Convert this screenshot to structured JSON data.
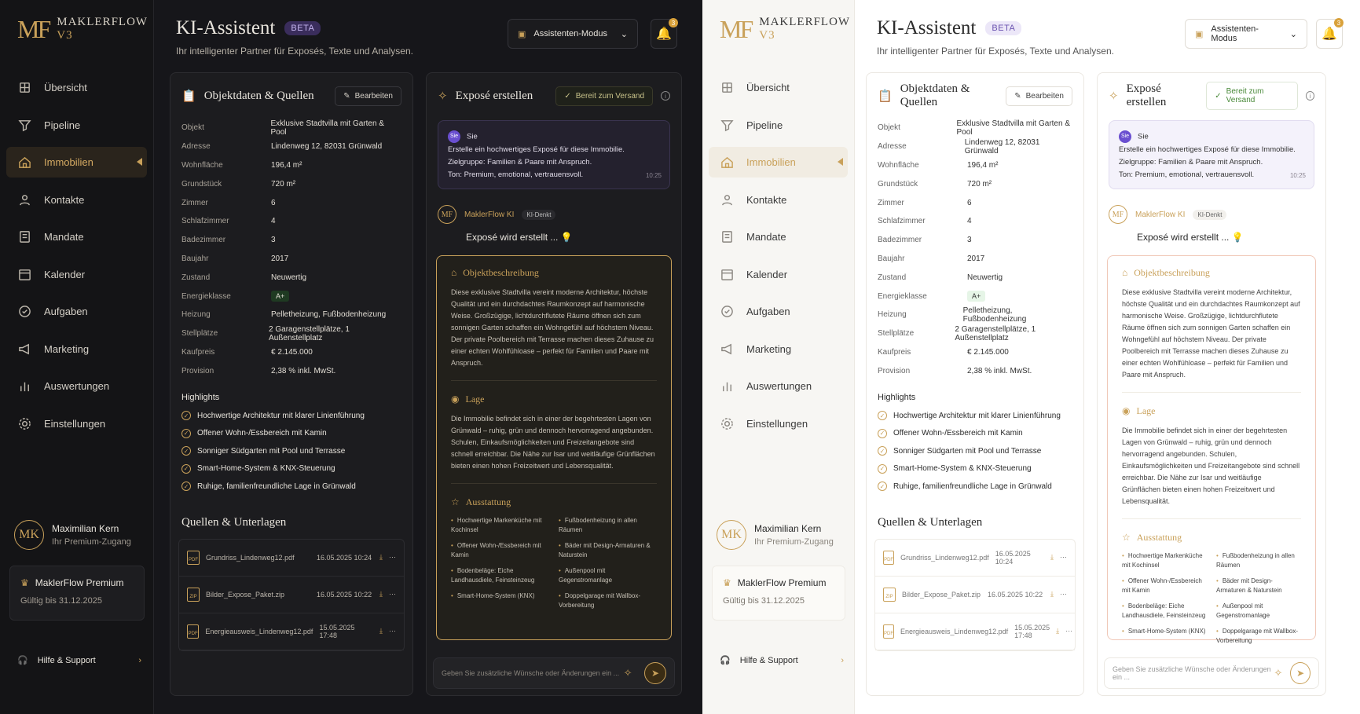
{
  "logo": {
    "mark": "MF",
    "text": "MAKLERFLOW",
    "version": "V3"
  },
  "nav": [
    "Übersicht",
    "Pipeline",
    "Immobilien",
    "Kontakte",
    "Mandate",
    "Kalender",
    "Aufgaben",
    "Marketing",
    "Auswertungen",
    "Einstellungen"
  ],
  "nav_icons": [
    "grid-icon",
    "funnel-icon",
    "home-icon",
    "contacts-icon",
    "contract-icon",
    "calendar-icon",
    "check-circle-icon",
    "megaphone-icon",
    "bar-chart-icon",
    "gear-icon"
  ],
  "user": {
    "initials": "MK",
    "name": "Maximilian Kern",
    "plan": "Ihr Premium-Zugang"
  },
  "premium": {
    "title": "MaklerFlow Premium",
    "valid": "Gültig bis 31.12.2025"
  },
  "help": "Hilfe & Support",
  "page": {
    "title": "KI-Assistent",
    "beta": "BETA",
    "subtitle": "Ihr intelligenter Partner für Exposés, Texte und Analysen.",
    "mode": "Assistenten-Modus",
    "notifications": "3"
  },
  "object": {
    "title": "Objektdaten & Quellen",
    "edit": "Bearbeiten",
    "rows": [
      {
        "k": "Objekt",
        "v": "Exklusive Stadtvilla mit Garten & Pool"
      },
      {
        "k": "Adresse",
        "v": "Lindenweg 12, 82031 Grünwald"
      },
      {
        "k": "Wohnfläche",
        "v": "196,4 m²"
      },
      {
        "k": "Grundstück",
        "v": "720 m²"
      },
      {
        "k": "Zimmer",
        "v": "6"
      },
      {
        "k": "Schlafzimmer",
        "v": "4"
      },
      {
        "k": "Badezimmer",
        "v": "3"
      },
      {
        "k": "Baujahr",
        "v": "2017"
      },
      {
        "k": "Zustand",
        "v": "Neuwertig"
      },
      {
        "k": "Energieklasse",
        "v": "A+"
      },
      {
        "k": "Heizung",
        "v": "Pelletheizung, Fußbodenheizung"
      },
      {
        "k": "Stellplätze",
        "v": "2 Garagenstellplätze, 1 Außenstellplatz"
      },
      {
        "k": "Kaufpreis",
        "v": "€ 2.145.000"
      },
      {
        "k": "Provision",
        "v": "2,38 % inkl. MwSt."
      }
    ],
    "highlights_title": "Highlights",
    "highlights": [
      "Hochwertige Architektur mit klarer Linienführung",
      "Offener Wohn-/Essbereich mit Kamin",
      "Sonniger Südgarten mit Pool und Terrasse",
      "Smart-Home-System & KNX-Steuerung",
      "Ruhige, familienfreundliche Lage in Grünwald"
    ],
    "sources_title": "Quellen & Unterlagen",
    "files": [
      {
        "name": "Grundriss_Lindenweg12.pdf",
        "date": "16.05.2025 10:24",
        "type": "PDF"
      },
      {
        "name": "Bilder_Expose_Paket.zip",
        "date": "16.05.2025 10:22",
        "type": "ZIP"
      },
      {
        "name": "Energieausweis_Lindenweg12.pdf",
        "date": "15.05.2025 17:48",
        "type": "PDF"
      }
    ]
  },
  "expose": {
    "title": "Exposé erstellen",
    "ready": "Bereit zum Versand",
    "user_label": "Sie",
    "user_avatar": "Sie",
    "user_lines": [
      "Erstelle ein hochwertiges Exposé für diese Immobilie.",
      "Zielgruppe: Familien & Paare mit Anspruch.",
      "Ton: Premium, emotional, vertrauensvoll."
    ],
    "user_time": "10:25",
    "ai_name": "MaklerFlow KI",
    "ai_tag": "KI-Denkt",
    "ai_status": "Exposé wird erstellt ...",
    "desc_title": "Objektbeschreibung",
    "desc_text": "Diese exklusive Stadtvilla vereint moderne Architektur, höchste Qualität und ein durchdachtes Raumkonzept auf harmonische Weise. Großzügige, lichtdurchflutete Räume öffnen sich zum sonnigen Garten schaffen ein Wohngefühl auf höchstem Niveau. Der private Poolbereich mit Terrasse machen dieses Zuhause zu einer echten Wohlfühloase – perfekt für Familien und Paare mit Anspruch.",
    "loc_title": "Lage",
    "loc_text": "Die Immobilie befindet sich in einer der begehrtesten Lagen von Grünwald – ruhig, grün und dennoch hervorragend angebunden. Schulen, Einkaufsmöglichkeiten und Freizeitangebote sind schnell erreichbar. Die Nähe zur Isar und weitläufige Grünflächen bieten einen hohen Freizeitwert und Lebensqualität.",
    "equip_title": "Ausstattung",
    "equip": [
      "Hochwertige Markenküche mit Kochinsel",
      "Fußbodenheizung in allen Räumen",
      "Offener Wohn-/Essbereich mit Kamin",
      "Bäder mit Design-Armaturen & Naturstein",
      "Bodenbeläge: Eiche Landhausdiele, Feinsteinzeug",
      "Außenpool mit Gegenstromanlage",
      "Smart-Home-System (KNX)",
      "Doppelgarage mit Wallbox-Vorbereitung"
    ],
    "input_placeholder": "Geben Sie zusätzliche Wünsche oder Änderungen ein ..."
  }
}
